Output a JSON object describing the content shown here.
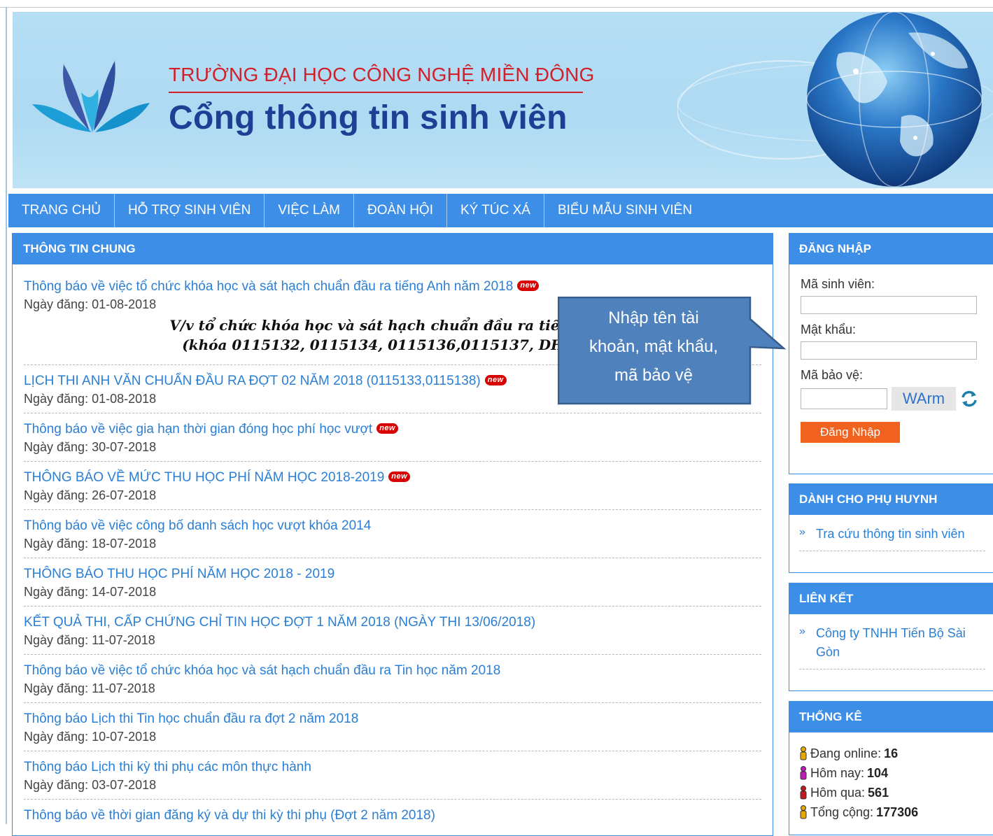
{
  "banner": {
    "school_name": "TRƯỜNG ĐẠI HỌC CÔNG NGHỆ MIỀN ĐÔNG",
    "portal_name": "Cổng thông tin sinh viên"
  },
  "nav": {
    "items": [
      "TRANG CHỦ",
      "HỖ TRỢ SINH VIÊN",
      "VIỆC LÀM",
      "ĐOÀN HỘI",
      "KÝ TÚC XÁ",
      "BIỂU MẪU SINH VIÊN"
    ]
  },
  "main": {
    "header": "THÔNG TIN CHUNG",
    "new_badge": "new",
    "excerpt_line1": "V/v tổ chức khóa học và sát hạch chuẩn đầu ra tiếng Anh",
    "excerpt_line2": "(khóa 0115132, 0115134, 0115136,0115137, DH1613",
    "news": [
      {
        "title": "Thông báo về việc tổ chức khóa học và sát hạch chuẩn đầu ra tiếng Anh năm 2018",
        "date": "Ngày đăng: 01-08-2018",
        "is_new": true
      },
      {
        "title": "LỊCH THI ANH VĂN CHUẨN ĐẦU RA ĐỢT 02 NĂM 2018 (0115133,0115138)",
        "date": "Ngày đăng: 01-08-2018",
        "is_new": true
      },
      {
        "title": "Thông báo về việc gia hạn thời gian đóng học phí học vượt",
        "date": "Ngày đăng: 30-07-2018",
        "is_new": true
      },
      {
        "title": "THÔNG BÁO VỀ MỨC THU HỌC PHÍ NĂM HỌC 2018-2019",
        "date": "Ngày đăng: 26-07-2018",
        "is_new": true
      },
      {
        "title": "Thông báo về việc công bố danh sách học vượt khóa 2014",
        "date": "Ngày đăng: 18-07-2018",
        "is_new": false
      },
      {
        "title": "THÔNG BÁO THU HỌC PHÍ NĂM HỌC 2018 - 2019",
        "date": "Ngày đăng: 14-07-2018",
        "is_new": false
      },
      {
        "title": "KẾT QUẢ THI, CẤP CHỨNG CHỈ TIN HỌC ĐỢT 1 NĂM 2018 (NGÀY THI 13/06/2018)",
        "date": "Ngày đăng: 11-07-2018",
        "is_new": false
      },
      {
        "title": "Thông báo về việc tổ chức khóa học và sát hạch chuẩn đầu ra Tin học năm 2018",
        "date": "Ngày đăng: 11-07-2018",
        "is_new": false
      },
      {
        "title": "Thông báo Lịch thi Tin học chuẩn đầu ra đợt 2 năm 2018",
        "date": "Ngày đăng: 10-07-2018",
        "is_new": false
      },
      {
        "title": "Thông báo Lịch thi kỳ thi phụ các môn thực hành",
        "date": "Ngày đăng: 03-07-2018",
        "is_new": false
      },
      {
        "title": "Thông báo về thời gian đăng ký và dự thi kỳ thi phụ (Đợt 2 năm 2018)",
        "date": "",
        "is_new": false
      }
    ]
  },
  "login": {
    "header": "ĐĂNG NHẬP",
    "student_id_label": "Mã sinh viên:",
    "password_label": "Mật khẩu:",
    "captcha_label": "Mã bảo vệ:",
    "captcha_code": "WArm",
    "submit_label": "Đăng Nhập"
  },
  "parents": {
    "header": "DÀNH CHO PHỤ HUYNH",
    "links": [
      "Tra cứu thông tin sinh viên"
    ]
  },
  "links": {
    "header": "LIÊN KẾT",
    "items": [
      "Công ty TNHH Tiến Bộ Sài Gòn"
    ]
  },
  "stats": {
    "header": "THỐNG KÊ",
    "rows": [
      {
        "label": "Đang online:",
        "value": "16",
        "color": "#e6a800"
      },
      {
        "label": "Hôm nay:",
        "value": "104",
        "color": "#c21cb8"
      },
      {
        "label": "Hôm qua:",
        "value": "561",
        "color": "#c2181f"
      },
      {
        "label": "Tổng cộng:",
        "value": "177306",
        "color": "#e6a800"
      }
    ]
  },
  "callout": {
    "line1": "Nhập tên tài",
    "line2": "khoản, mật khẩu,",
    "line3": "mã bảo vệ"
  },
  "colors": {
    "primary": "#3d8ee6",
    "link": "#2a7fd4",
    "brand_red": "#d1202a",
    "brand_navy": "#1f3f95",
    "button_orange": "#f1621f",
    "callout_fill": "#4f81bd"
  }
}
